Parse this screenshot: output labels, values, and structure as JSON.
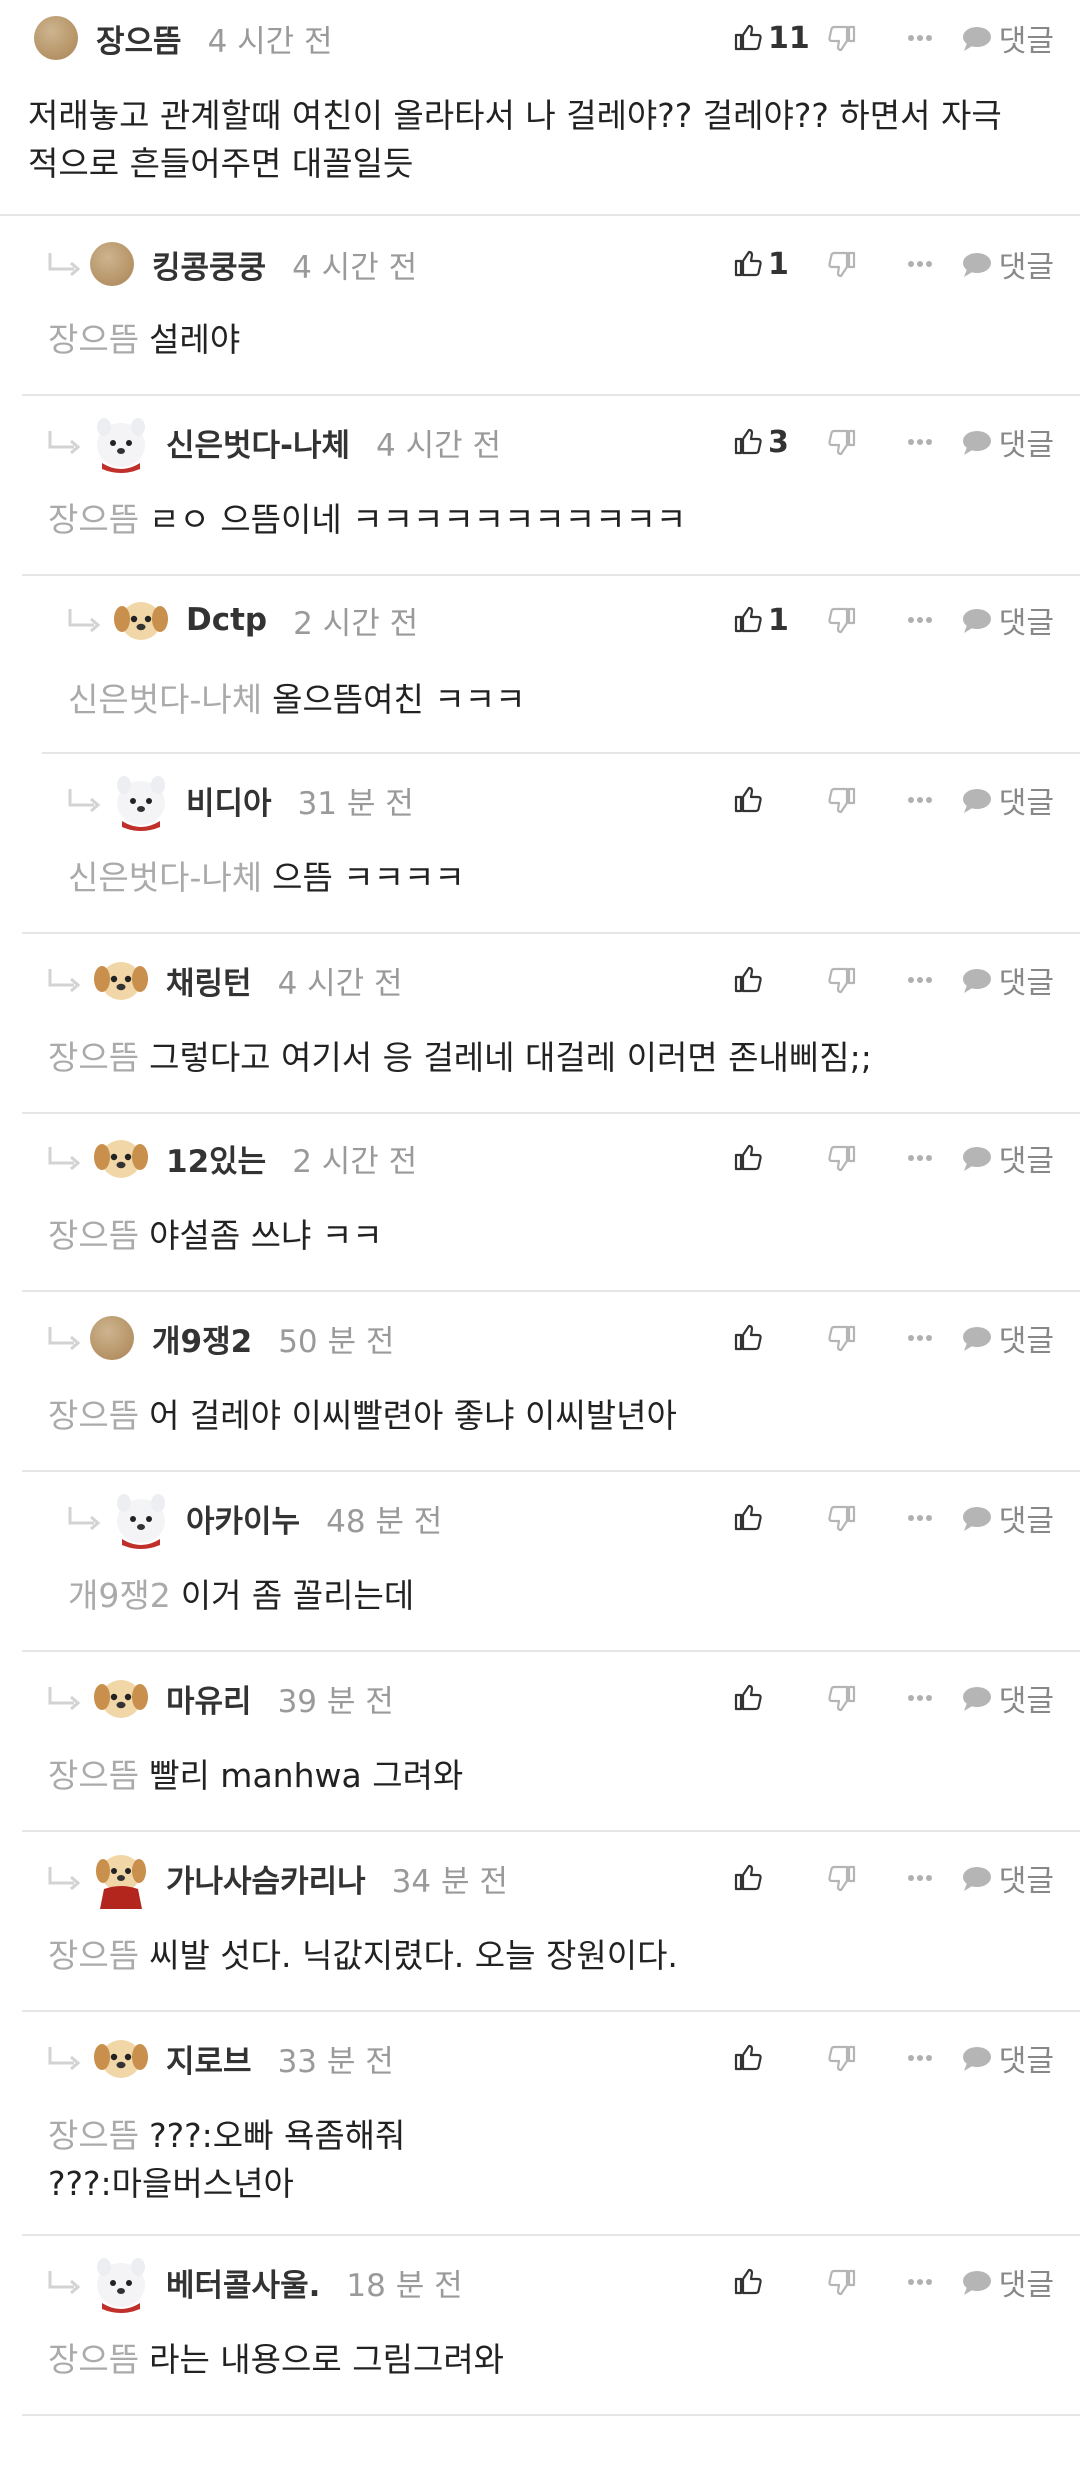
{
  "labels": {
    "reply": "댓글"
  },
  "comments": [
    {
      "nick": "장으뜸",
      "time": "4 시간 전",
      "likes": "11",
      "mention": "",
      "lines": [
        "저래놓고 관계할때 여친이 올라타서 나 걸레야?? 걸레야?? 하면서 자극",
        "적으로 흔들어주면 대꼴일듯"
      ]
    },
    {
      "nick": "킹콩쿵쿵",
      "time": "4 시간 전",
      "likes": "1",
      "mention": "장으뜸",
      "lines": [
        "설레야"
      ]
    },
    {
      "nick": "신은벗다-나체",
      "time": "4 시간 전",
      "likes": "3",
      "mention": "장으뜸",
      "lines": [
        "ㄹㅇ 으뜸이네 ㅋㅋㅋㅋㅋㅋㅋㅋㅋㅋㅋ"
      ]
    },
    {
      "nick": "Dctp",
      "time": "2 시간 전",
      "likes": "1",
      "mention": "신은벗다-나체",
      "lines": [
        "올으뜸여친 ㅋㅋㅋ"
      ]
    },
    {
      "nick": "비디아",
      "time": "31 분 전",
      "likes": "",
      "mention": "신은벗다-나체",
      "lines": [
        "으뜸 ㅋㅋㅋㅋ"
      ]
    },
    {
      "nick": "채링턴",
      "time": "4 시간 전",
      "likes": "",
      "mention": "장으뜸",
      "lines": [
        "그렇다고 여기서 응 걸레네 대걸레 이러면 존내삐짐;;"
      ]
    },
    {
      "nick": "12있는",
      "time": "2 시간 전",
      "likes": "",
      "mention": "장으뜸",
      "lines": [
        "야설좀 쓰냐 ㅋㅋ"
      ]
    },
    {
      "nick": "개9쟁2",
      "time": "50 분 전",
      "likes": "",
      "mention": "장으뜸",
      "lines": [
        "어 걸레야 이씨빨련아 좋냐 이씨발년아"
      ]
    },
    {
      "nick": "아카이누",
      "time": "48 분 전",
      "likes": "",
      "mention": "개9쟁2",
      "lines": [
        "이거 좀 꼴리는데"
      ]
    },
    {
      "nick": "마유리",
      "time": "39 분 전",
      "likes": "",
      "mention": "장으뜸",
      "lines": [
        "빨리 manhwa 그려와"
      ]
    },
    {
      "nick": "가나사슴카리나",
      "time": "34 분 전",
      "likes": "",
      "mention": "장으뜸",
      "lines": [
        "씨발 섯다. 닉값지렸다. 오늘 장원이다."
      ]
    },
    {
      "nick": "지로브",
      "time": "33 분 전",
      "likes": "",
      "mention": "장으뜸",
      "lines": [
        "???:오빠 욕좀해줘",
        "???:마을버스년아"
      ]
    },
    {
      "nick": "베터콜사울.",
      "time": "18 분 전",
      "likes": "",
      "mention": "장으뜸",
      "lines": [
        "라는 내용으로 그림그려와"
      ]
    }
  ]
}
